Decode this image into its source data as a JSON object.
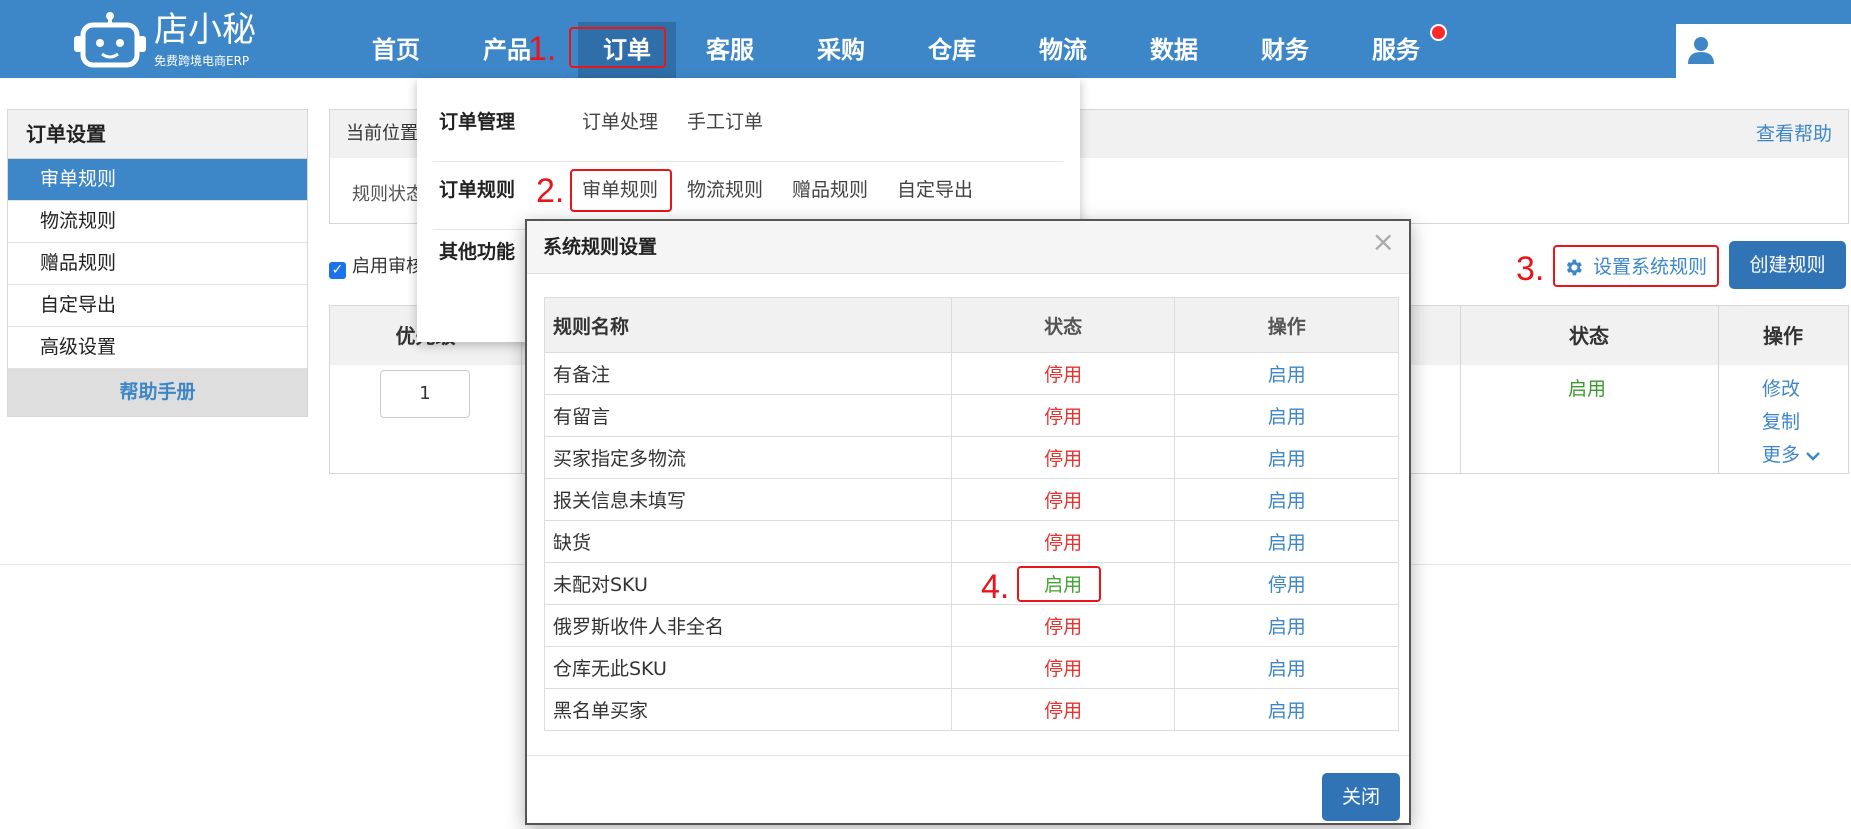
{
  "app": {
    "logo_name": "店小秘",
    "logo_sub": "免费跨境电商ERP"
  },
  "nav": {
    "items": [
      "首页",
      "产品",
      "订单",
      "客服",
      "采购",
      "仓库",
      "物流",
      "数据",
      "财务",
      "服务"
    ],
    "active": "订单"
  },
  "annotations": {
    "step1": "1.",
    "step2": "2.",
    "step3": "3.",
    "step4": "4."
  },
  "sidebar": {
    "title": "订单设置",
    "items": [
      "审单规则",
      "物流规则",
      "赠品规则",
      "自定导出",
      "高级设置"
    ],
    "active": "审单规则",
    "help": "帮助手册"
  },
  "breadcrumb": {
    "label": "当前位置",
    "help_link": "查看帮助"
  },
  "filter": {
    "label": "规则状态"
  },
  "toolbar": {
    "enable_label": "启用审核",
    "set_system_rules": "设置系统规则",
    "create_rule": "创建规则"
  },
  "rules_table": {
    "headers": {
      "priority": "优先级",
      "status": "状态",
      "op": "操作"
    },
    "row": {
      "priority": "1",
      "status": "启用",
      "ops": [
        "修改",
        "复制",
        "更多"
      ]
    }
  },
  "dropdown": {
    "rows": [
      {
        "category": "订单管理",
        "links": [
          "订单处理",
          "手工订单"
        ]
      },
      {
        "category": "订单规则",
        "links": [
          "审单规则",
          "物流规则",
          "赠品规则",
          "自定导出"
        ]
      },
      {
        "category": "其他功能",
        "links": []
      }
    ]
  },
  "modal": {
    "title": "系统规则设置",
    "close_icon": "×",
    "headers": {
      "name": "规则名称",
      "status": "状态",
      "op": "操作"
    },
    "rows": [
      {
        "name": "有备注",
        "status": "停用",
        "op": "启用"
      },
      {
        "name": "有留言",
        "status": "停用",
        "op": "启用"
      },
      {
        "name": "买家指定多物流",
        "status": "停用",
        "op": "启用"
      },
      {
        "name": "报关信息未填写",
        "status": "停用",
        "op": "启用"
      },
      {
        "name": "缺货",
        "status": "停用",
        "op": "启用"
      },
      {
        "name": "未配对SKU",
        "status": "启用",
        "op": "停用"
      },
      {
        "name": "俄罗斯收件人非全名",
        "status": "停用",
        "op": "启用"
      },
      {
        "name": "仓库无此SKU",
        "status": "停用",
        "op": "启用"
      },
      {
        "name": "黑名单买家",
        "status": "停用",
        "op": "启用"
      }
    ],
    "close_button": "关闭"
  },
  "colors": {
    "brand": "#3d87c8",
    "annotation_red": "#e8151b",
    "status_off": "#e8332f",
    "status_on": "#43a536"
  },
  "icons": [
    "robot-logo-icon",
    "notification-dot-icon",
    "user-icon",
    "gear-icon",
    "chevron-down-icon",
    "close-icon",
    "checkbox-checked-icon"
  ]
}
